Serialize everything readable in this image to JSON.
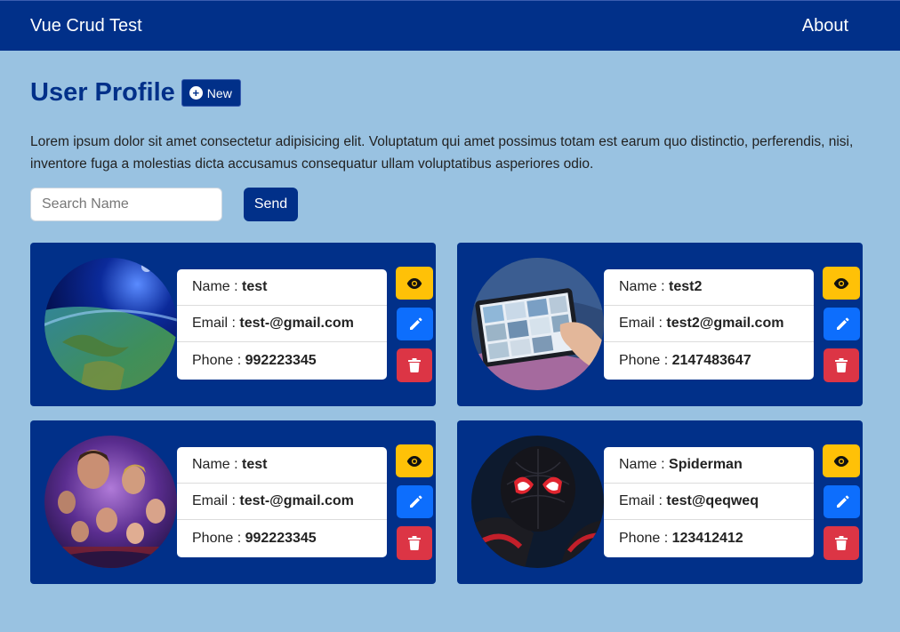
{
  "navbar": {
    "brand": "Vue Crud Test",
    "about": "About"
  },
  "header": {
    "title": "User Profile",
    "new_label": "New"
  },
  "intro": "Lorem ipsum dolor sit amet consectetur adipisicing elit. Voluptatum qui amet possimus totam est earum quo distinctio, perferendis, nisi, inventore fuga a molestias dicta accusamus consequatur ullam voluptatibus asperiores odio.",
  "search": {
    "placeholder": "Search Name",
    "value": "",
    "send_label": "Send"
  },
  "labels": {
    "name": "Name : ",
    "email": "Email : ",
    "phone": "Phone : "
  },
  "users": [
    {
      "name": "test",
      "email": "test-@gmail.com",
      "phone": "992223345",
      "avatar": "earth-from-space-image"
    },
    {
      "name": "test2",
      "email": "test2@gmail.com",
      "phone": "2147483647",
      "avatar": "tablet-photos-image"
    },
    {
      "name": "test",
      "email": "test-@gmail.com",
      "phone": "992223345",
      "avatar": "avengers-poster-image"
    },
    {
      "name": "Spiderman",
      "email": "test@qeqweq",
      "phone": "123412412",
      "avatar": "spiderman-image"
    }
  ],
  "colors": {
    "background": "#99c2e1",
    "primary": "#013089",
    "view": "#ffc107",
    "edit": "#0d6efd",
    "delete": "#dc3545"
  }
}
